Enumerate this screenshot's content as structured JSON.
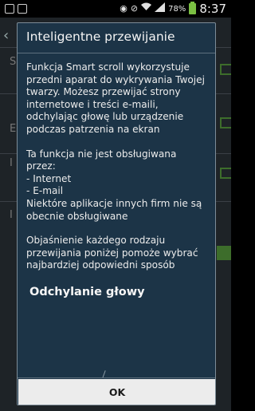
{
  "status_bar": {
    "battery_percent": "78%",
    "time": "8:37",
    "icons": [
      "notification-icon",
      "image-icon",
      "eye-icon",
      "mute-icon",
      "wifi-icon",
      "signal-icon",
      "battery-icon"
    ]
  },
  "dialog": {
    "title": "Inteligentne przewijanie",
    "paragraph1": "Funkcja Smart scroll wykorzystuje przedni aparat do wykrywania Twojej twarzy. Możesz przewijać strony internetowe i treści e-maili, odchylając głowę lub urządzenie podczas patrzenia na ekran",
    "paragraph2_intro": "Ta funkcja nie jest obsługiwana przez:",
    "unsupported_items": [
      "- Internet",
      "- E-mail"
    ],
    "paragraph2_end": "Niektóre aplikacje innych firm nie są obecnie obsługiwane",
    "paragraph3": "Objaśnienie każdego rodzaju przewijania poniżej pomoże wybrać najbardziej odpowiedni sposób",
    "subheading": "Odchylanie głowy",
    "ok_label": "OK"
  },
  "background_letters": [
    "S",
    "E",
    "I",
    "I",
    "I"
  ],
  "colors": {
    "dialog_bg": "#1c3447",
    "accent_green": "#3d6d2b",
    "battery_green": "#7bc043",
    "ok_button_bg": "#ececec"
  }
}
